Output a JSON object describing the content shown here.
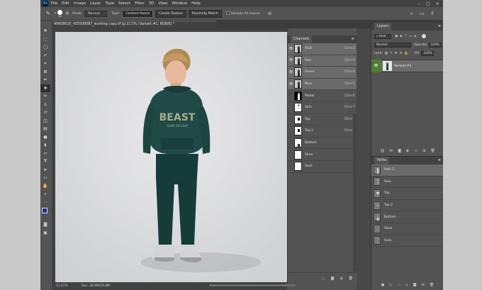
{
  "menubar": {
    "logo": "Ps",
    "items": [
      "File",
      "Edit",
      "Image",
      "Layer",
      "Type",
      "Select",
      "Filter",
      "3D",
      "View",
      "Window",
      "Help"
    ],
    "window_controls": [
      "–",
      "□",
      "✕"
    ]
  },
  "options_bar": {
    "brush_size": "80",
    "mode_label": "Mode:",
    "mode_value": "Normal",
    "type_label": "Type:",
    "content_aware": "Content-Aware",
    "create_texture": "Create Texture",
    "proximity_match": "Proximity Match",
    "sample_all_layers": "Sample All Layers"
  },
  "document": {
    "tab_title": "49608016_435508087_working copy.tif @ 21.5% (Variant #1, RGB/8) *",
    "zoom": "21.47%",
    "doc_info": "Doc: 38.6M/59.0M",
    "shirt_text_line1": "BEAST",
    "shirt_text_line2": "GAME ON 2000"
  },
  "channels_panel": {
    "title": "Channels",
    "rows": [
      {
        "name": "RGB",
        "shortcut": "Ctrl+2",
        "visible": true,
        "selected": true,
        "thumb": "photo"
      },
      {
        "name": "Red",
        "shortcut": "Ctrl+3",
        "visible": true,
        "selected": true,
        "thumb": "photo"
      },
      {
        "name": "Green",
        "shortcut": "Ctrl+4",
        "visible": true,
        "selected": true,
        "thumb": "photo"
      },
      {
        "name": "Blue",
        "shortcut": "Ctrl+5",
        "visible": true,
        "selected": true,
        "thumb": "photo"
      },
      {
        "name": "Model",
        "shortcut": "Ctrl+6",
        "visible": false,
        "selected": false,
        "thumb": "silhouette"
      },
      {
        "name": "Skin",
        "shortcut": "Ctrl+7",
        "visible": false,
        "selected": false,
        "thumb": "skin"
      },
      {
        "name": "Top",
        "shortcut": "Ctrl+8",
        "visible": false,
        "selected": false,
        "thumb": "top"
      },
      {
        "name": "Top 2",
        "shortcut": "Ctrl+9",
        "visible": false,
        "selected": false,
        "thumb": "top"
      },
      {
        "name": "Bottom",
        "shortcut": "",
        "visible": false,
        "selected": false,
        "thumb": "bottom"
      },
      {
        "name": "Shoe",
        "shortcut": "",
        "visible": false,
        "selected": false,
        "thumb": "blank"
      },
      {
        "name": "Sock",
        "shortcut": "",
        "visible": false,
        "selected": false,
        "thumb": "blank"
      }
    ]
  },
  "layers_panel": {
    "title": "Layers",
    "kind_label": "Kind",
    "blend_mode": "Normal",
    "opacity_label": "Opacity:",
    "opacity_value": "100%",
    "lock_label": "Lock:",
    "fill_label": "Fill:",
    "fill_value": "100%",
    "layer_name": "Variant #1"
  },
  "paths_panel": {
    "title": "Paths",
    "rows": [
      "Path 1",
      "Skin",
      "Top",
      "Top 2",
      "Bottom",
      "Shoe",
      "Sock"
    ]
  },
  "colors": {
    "hoodie": "#1f4a47",
    "pants": "#163c3a",
    "foreground": "#2a2aa0",
    "visibility_green": "#4f7f2e"
  }
}
